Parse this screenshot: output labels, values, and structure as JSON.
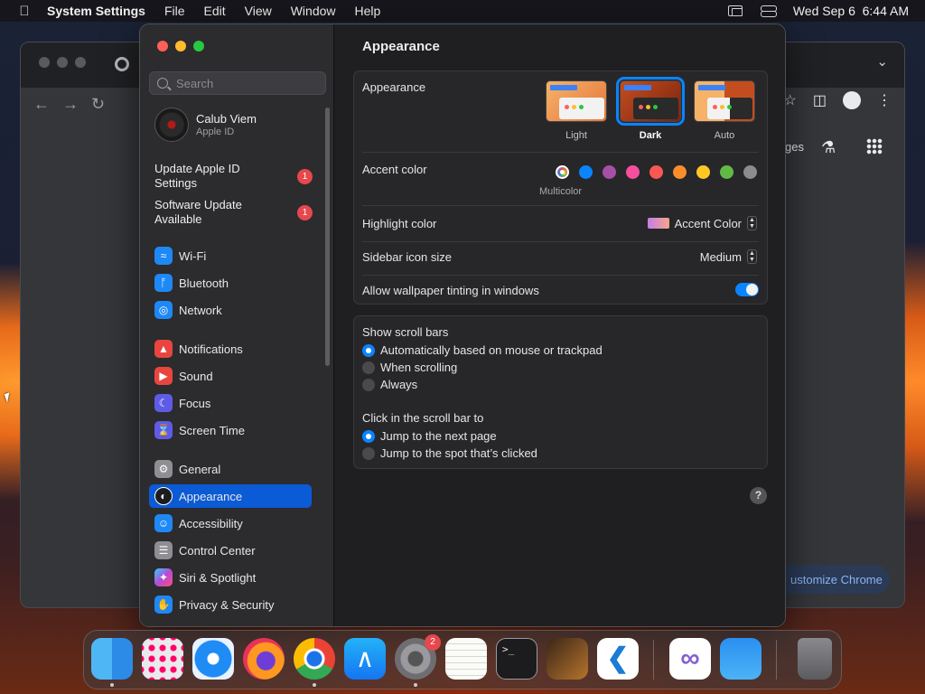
{
  "menubar": {
    "apple_icon": "apple-logo-icon",
    "app_name": "System Settings",
    "items": [
      "File",
      "Edit",
      "View",
      "Window",
      "Help"
    ],
    "datetime": "Wed Sep 6  6:44 AM",
    "status_icons": [
      "screen-mirroring-icon",
      "spotlight-search-icon",
      "control-center-icon"
    ]
  },
  "chrome_background": {
    "partial_text": "ges",
    "customize_label": "ustomize Chrome"
  },
  "window": {
    "sidebar": {
      "search_placeholder": "Search",
      "profile": {
        "name": "Calub Viem",
        "subtitle": "Apple ID"
      },
      "notices": [
        {
          "label": "Update Apple ID Settings",
          "badge": "1"
        },
        {
          "label": "Software Update Available",
          "badge": "1"
        }
      ],
      "items": [
        {
          "label": "Wi-Fi",
          "icon": "wifi-icon",
          "color": "#1e88f5"
        },
        {
          "label": "Bluetooth",
          "icon": "bluetooth-icon",
          "color": "#1e88f5"
        },
        {
          "label": "Network",
          "icon": "globe-icon",
          "color": "#1e88f5"
        },
        {
          "label": "Notifications",
          "icon": "bell-icon",
          "color": "#e9453f"
        },
        {
          "label": "Sound",
          "icon": "speaker-icon",
          "color": "#e9453f"
        },
        {
          "label": "Focus",
          "icon": "moon-icon",
          "color": "#5e5ce6"
        },
        {
          "label": "Screen Time",
          "icon": "hourglass-icon",
          "color": "#5e5ce6"
        },
        {
          "label": "General",
          "icon": "gear-icon",
          "color": "#8e8e93"
        },
        {
          "label": "Appearance",
          "icon": "appearance-icon",
          "color": "#1c1c1e"
        },
        {
          "label": "Accessibility",
          "icon": "accessibility-icon",
          "color": "#1e88f5"
        },
        {
          "label": "Control Center",
          "icon": "toggles-icon",
          "color": "#8e8e93"
        },
        {
          "label": "Siri & Spotlight",
          "icon": "siri-icon",
          "color": "#b44bd6"
        },
        {
          "label": "Privacy & Security",
          "icon": "hand-icon",
          "color": "#1e88f5"
        }
      ],
      "active_item": "Appearance"
    },
    "main": {
      "title": "Appearance",
      "appearance": {
        "label": "Appearance",
        "options": [
          {
            "label": "Light",
            "selected": false
          },
          {
            "label": "Dark",
            "selected": true
          },
          {
            "label": "Auto",
            "selected": false
          }
        ]
      },
      "accent": {
        "label": "Accent color",
        "selected_name": "Multicolor",
        "colors": [
          "multicolor",
          "#0a84ff",
          "#a550a7",
          "#f74f9e",
          "#fc5753",
          "#fd8d2a",
          "#ffc726",
          "#62ba46",
          "#8c8c8c"
        ]
      },
      "highlight": {
        "label": "Highlight color",
        "value": "Accent Color"
      },
      "sidebar_icon_size": {
        "label": "Sidebar icon size",
        "value": "Medium"
      },
      "wallpaper_tinting": {
        "label": "Allow wallpaper tinting in windows",
        "enabled": true
      },
      "scroll_bars": {
        "label": "Show scroll bars",
        "options": [
          {
            "label": "Automatically based on mouse or trackpad",
            "selected": true
          },
          {
            "label": "When scrolling",
            "selected": false
          },
          {
            "label": "Always",
            "selected": false
          }
        ]
      },
      "click_scroll_bar": {
        "label": "Click in the scroll bar to",
        "options": [
          {
            "label": "Jump to the next page",
            "selected": true
          },
          {
            "label": "Jump to the spot that’s clicked",
            "selected": false
          }
        ]
      },
      "help_label": "?"
    }
  },
  "dock": {
    "apps": [
      {
        "name": "Finder",
        "icon": "finder-icon",
        "running": true
      },
      {
        "name": "Launchpad",
        "icon": "launchpad-icon",
        "running": false
      },
      {
        "name": "Safari",
        "icon": "safari-icon",
        "running": false
      },
      {
        "name": "Firefox",
        "icon": "firefox-icon",
        "running": false
      },
      {
        "name": "Google Chrome",
        "icon": "chrome-icon",
        "running": true
      },
      {
        "name": "App Store",
        "icon": "app-store-icon",
        "running": false
      },
      {
        "name": "System Settings",
        "icon": "system-settings-icon",
        "running": true,
        "badge": "2"
      },
      {
        "name": "TextEdit",
        "icon": "textedit-icon",
        "running": false
      },
      {
        "name": "Terminal",
        "icon": "terminal-icon",
        "running": false
      },
      {
        "name": "GarageBand",
        "icon": "garageband-icon",
        "running": false
      },
      {
        "name": "Visual Studio Code",
        "icon": "vscode-icon",
        "running": false
      },
      {
        "name": "Visual Studio",
        "icon": "visual-studio-icon",
        "running": false
      },
      {
        "name": "Weather",
        "icon": "weather-icon",
        "running": false
      },
      {
        "name": "Trash",
        "icon": "trash-icon",
        "running": false
      }
    ],
    "terminal_prompt": ">_"
  }
}
